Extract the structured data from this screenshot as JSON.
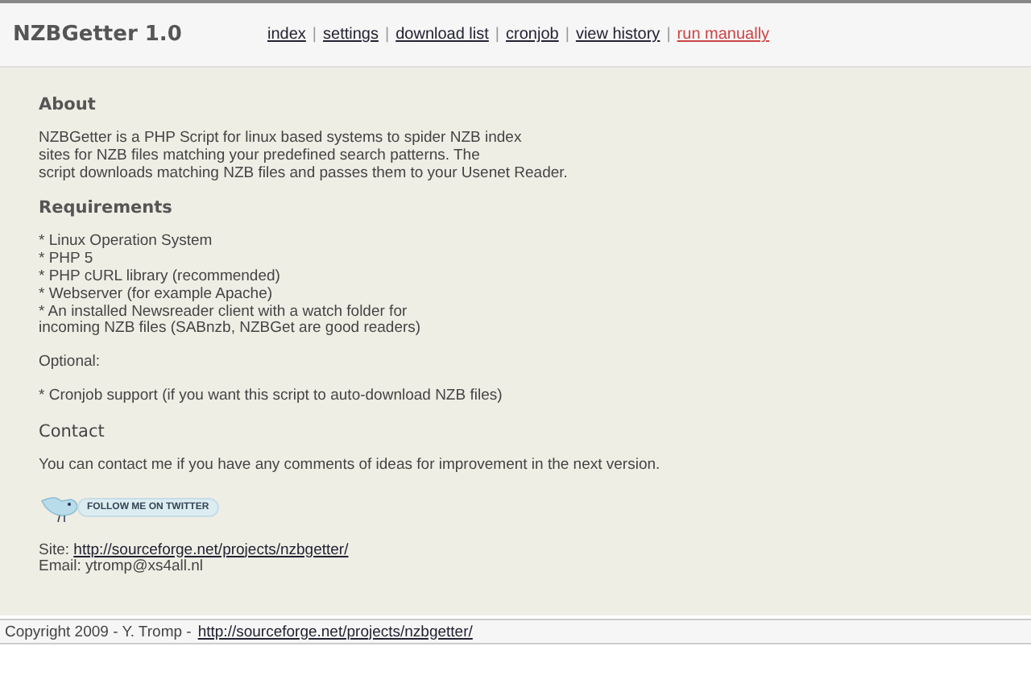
{
  "header": {
    "title": "NZBGetter 1.0",
    "nav": [
      {
        "label": "index",
        "selected": false
      },
      {
        "label": "settings",
        "selected": false
      },
      {
        "label": "download list",
        "selected": false
      },
      {
        "label": "cronjob",
        "selected": false
      },
      {
        "label": "view history",
        "selected": false
      },
      {
        "label": "run manually",
        "selected": true
      }
    ],
    "separator": "|"
  },
  "about": {
    "heading": "About",
    "lines": [
      "NZBGetter is a PHP Script for linux based systems to spider NZB index",
      "sites for NZB files matching your predefined search patterns. The",
      "script downloads matching NZB files and passes them to your Usenet Reader."
    ]
  },
  "requirements": {
    "heading": "Requirements",
    "lines": [
      "* Linux Operation System",
      "* PHP 5",
      "* PHP cURL library (recommended)",
      "* Webserver (for example Apache)",
      "* An installed Newsreader client with a watch folder for",
      "incoming NZB files (SABnzb, NZBGet are good readers)"
    ],
    "optional_label": "Optional:",
    "optional_lines": [
      "* Cronjob support (if you want this script to auto-download NZB files)"
    ]
  },
  "contact": {
    "heading": "Contact",
    "text": "You can contact me if you have any comments of ideas for improvement in the next version.",
    "twitter_button": "FOLLOW ME ON TWITTER",
    "site_label": "Site:",
    "site_link": "http://sourceforge.net/projects/nzbgetter/",
    "email": "Email: ytromp@xs4all.nl"
  },
  "footer": {
    "text": "Copyright 2009 - Y. Tromp -",
    "link": "http://sourceforge.net/projects/nzbgetter/"
  }
}
